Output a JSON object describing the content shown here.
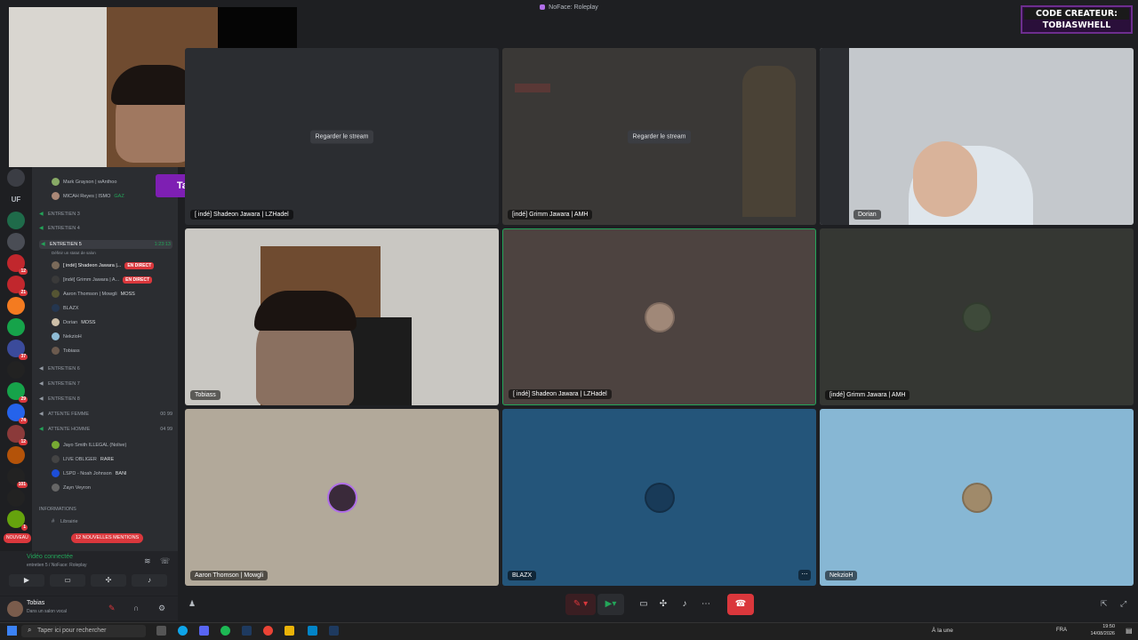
{
  "window": {
    "title": "NoFace: Roleplay"
  },
  "brand": {
    "line1": "CODE CREATEUR:",
    "line2": "TOBIASWHELL"
  },
  "overlay": {
    "tape_text": "Tape !don dans le chat"
  },
  "rail": {
    "label_uf": "UF",
    "badges": [
      "12",
      "21",
      "37",
      "29",
      "74",
      "12",
      "101",
      "1"
    ],
    "nouveau": "NOUVEAU"
  },
  "sidebar": {
    "channels": [
      {
        "name": "Mark Grayson | wAnthoo",
        "type": "user"
      },
      {
        "name": "MICAH Reyes | ISMO",
        "type": "user",
        "tag": "GAZ"
      },
      {
        "name": "ENTRETIEN 3",
        "type": "channel"
      },
      {
        "name": "ENTRETIEN 4",
        "type": "channel"
      },
      {
        "name": "ENTRETIEN 5",
        "type": "channel",
        "time": "1:23:13"
      },
      {
        "name": "Définir un statut de salon",
        "type": "hint"
      },
      {
        "name": "[ indé] Shadeon Jawara |...",
        "type": "user",
        "live": "EN DIRECT"
      },
      {
        "name": "[indé] Grimm Jawara | A...",
        "type": "user",
        "live": "EN DIRECT"
      },
      {
        "name": "Aaron Thomson | Mowgli",
        "type": "user",
        "tag": "MOSS"
      },
      {
        "name": "BLAZX",
        "type": "user"
      },
      {
        "name": "Dorian",
        "type": "user",
        "tag": "MOSS"
      },
      {
        "name": "NekzioH",
        "type": "user"
      },
      {
        "name": "Tobiass",
        "type": "user"
      },
      {
        "name": "ENTRETIEN 6",
        "type": "channel"
      },
      {
        "name": "ENTRETIEN 7",
        "type": "channel"
      },
      {
        "name": "ENTRETIEN 8",
        "type": "channel"
      },
      {
        "name": "ATTENTE FEMME",
        "type": "channel",
        "count": "00 99"
      },
      {
        "name": "ATTENTE HOMME",
        "type": "channel",
        "count": "04 99"
      },
      {
        "name": "Jayo Smith ILLEGAL (Nolive)",
        "type": "user"
      },
      {
        "name": "LIVE OBLIGER",
        "type": "user",
        "tag": "RARE"
      },
      {
        "name": "LSPD - Noah Johnson",
        "type": "user",
        "tag": "BANI"
      },
      {
        "name": "Zayn Veyron",
        "type": "user"
      },
      {
        "name": "INFORMATIONS",
        "type": "category"
      },
      {
        "name": "Librairie",
        "type": "text"
      }
    ],
    "mentions_badge": "12 NOUVELLES MENTIONS"
  },
  "voice_panel": {
    "status": "Vidéo connectée",
    "channel": "entretien 5 / NoFace: Roleplay"
  },
  "user_panel": {
    "name": "Tobias",
    "status": "Dans un salon vocal"
  },
  "grid": {
    "tiles": [
      {
        "label": "[ indé] Shadeon Jawara | LZHadel",
        "button": "Regarder le stream"
      },
      {
        "label": "[indé] Grimm Jawara | AMH",
        "button": "Regarder le stream"
      },
      {
        "label": "Dorian"
      },
      {
        "label": "Tobiass"
      },
      {
        "label": "[ indé] Shadeon Jawara | LZHadel"
      },
      {
        "label": "[indé] Grimm Jawara | AMH"
      },
      {
        "label": "Aaron Thomson | Mowgli"
      },
      {
        "label": "BLAZX"
      },
      {
        "label": "NekzioH"
      }
    ]
  },
  "taskbar": {
    "search_placeholder": "Taper ici pour rechercher",
    "weather": "À la une",
    "lang": "FRA",
    "time": "19:50",
    "date": "14/08/2026"
  },
  "colors": {
    "accent_purple": "#7e1fb3",
    "live_red": "#da373c",
    "online_green": "#23a559",
    "hangup_red": "#da373c"
  }
}
